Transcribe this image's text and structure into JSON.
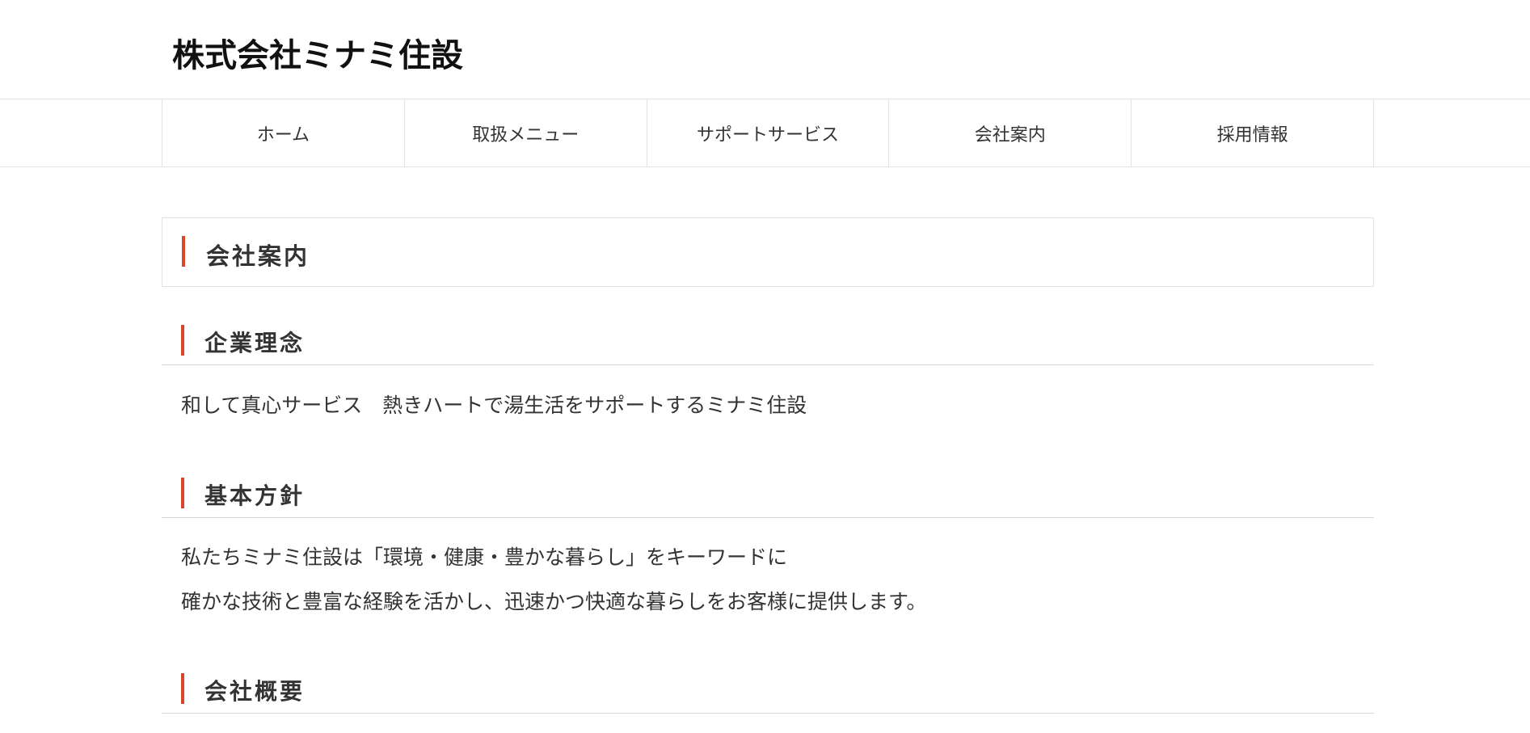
{
  "header": {
    "logo_text": "株式会社ミナミ住設"
  },
  "nav": {
    "items": [
      {
        "label": "ホーム"
      },
      {
        "label": "取扱メニュー"
      },
      {
        "label": "サポートサービス"
      },
      {
        "label": "会社案内"
      },
      {
        "label": "採用情報"
      }
    ]
  },
  "page": {
    "title": "会社案内"
  },
  "sections": {
    "philosophy": {
      "heading": "企業理念",
      "lines": [
        "和して真心サービス　熱きハートで湯生活をサポートするミナミ住設"
      ]
    },
    "policy": {
      "heading": "基本方針",
      "lines": [
        "私たちミナミ住設は「環境・健康・豊かな暮らし」をキーワードに",
        "確かな技術と豊富な経験を活かし、迅速かつ快適な暮らしをお客様に提供します。"
      ]
    },
    "overview": {
      "heading": "会社概要"
    }
  },
  "colors": {
    "accent": "#d9472b",
    "border": "#e3e3e3",
    "text": "#333333"
  }
}
